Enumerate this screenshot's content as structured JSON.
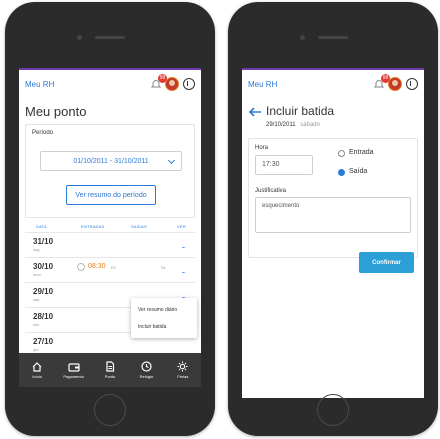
{
  "app": {
    "brand": "Meu RH",
    "notification_count": "99"
  },
  "phone1": {
    "title": "Meu ponto",
    "period_label": "Período",
    "period_value": "01/10/2011 - 31/10/2011",
    "summary_button": "Ver resumo do período",
    "table_headers": [
      "DATA",
      "ENTRADAS",
      "SAÍDAS",
      "VER"
    ],
    "rows": [
      {
        "date": "31/10",
        "weekday": "seg"
      },
      {
        "date": "30/10",
        "weekday": "dom",
        "entry_time": "08:30",
        "entry_tag": "E1",
        "exit_tag": "S1"
      },
      {
        "date": "29/10",
        "weekday": "sáb"
      },
      {
        "date": "28/10",
        "weekday": "sex"
      },
      {
        "date": "27/10",
        "weekday": "qui"
      }
    ],
    "more_glyph": "...",
    "context_menu": [
      "Ver resumo diário",
      "Incluir batida"
    ],
    "tabs": [
      "Início",
      "Pagamento",
      "Ponto",
      "Relógio",
      "Férias"
    ]
  },
  "phone2": {
    "title": "Incluir batida",
    "date": "29/10/2011",
    "weekday": "sábado",
    "hour_label": "Hora",
    "hour_value": "17:30",
    "radio_entry": "Entrada",
    "radio_exit": "Saída",
    "selected": "Saída",
    "justification_label": "Justificativa",
    "justification_value": "esquecimento",
    "confirm_button": "Confirmar"
  },
  "colors": {
    "accent": "#2b7bd6",
    "confirm": "#2b9fd6",
    "topline": "#6a3aa8",
    "tabbar": "#3a3a3a",
    "alert": "#e53935"
  }
}
